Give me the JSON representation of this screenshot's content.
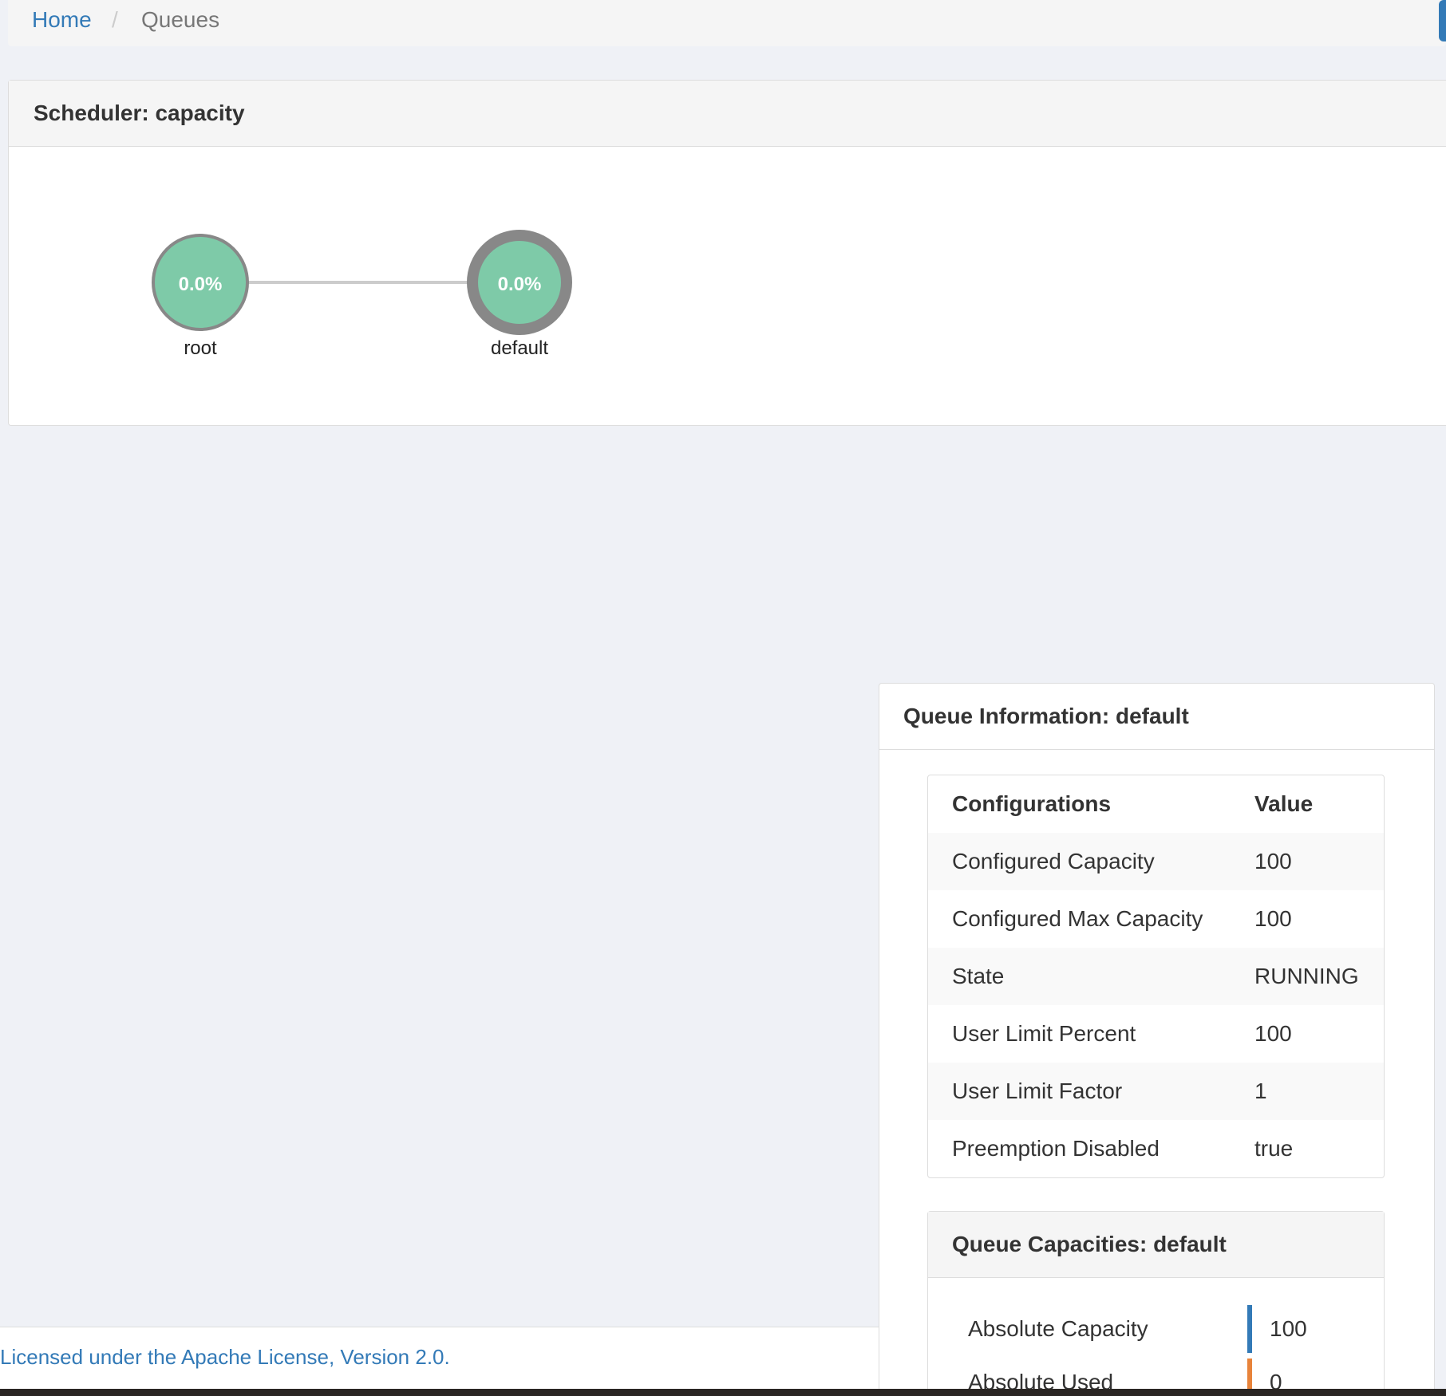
{
  "breadcrumb": {
    "home": "Home",
    "separator": "/",
    "current": "Queues"
  },
  "scheduler": {
    "title": "Scheduler: capacity",
    "nodes": [
      {
        "name": "root",
        "usage": "0.0%",
        "selected": false
      },
      {
        "name": "default",
        "usage": "0.0%",
        "selected": true
      }
    ]
  },
  "queue_info": {
    "title": "Queue Information: default",
    "table": {
      "headers": [
        "Configurations",
        "Value"
      ],
      "rows": [
        [
          "Configured Capacity",
          "100"
        ],
        [
          "Configured Max Capacity",
          "100"
        ],
        [
          "State",
          "RUNNING"
        ],
        [
          "User Limit Percent",
          "100"
        ],
        [
          "User Limit Factor",
          "1"
        ],
        [
          "Preemption Disabled",
          "true"
        ]
      ]
    }
  },
  "queue_capacities": {
    "title": "Queue Capacities: default",
    "rows": [
      {
        "label": "Absolute Capacity",
        "value": "100",
        "color": "#337ab7"
      },
      {
        "label": "Absolute Used",
        "value": "0",
        "color": "#e8833a"
      }
    ]
  },
  "footer": {
    "license": "Licensed under the Apache License, Version 2.0."
  },
  "colors": {
    "node_fill": "#7ecaa8",
    "node_stroke": "#888888",
    "link": "#cccccc"
  }
}
